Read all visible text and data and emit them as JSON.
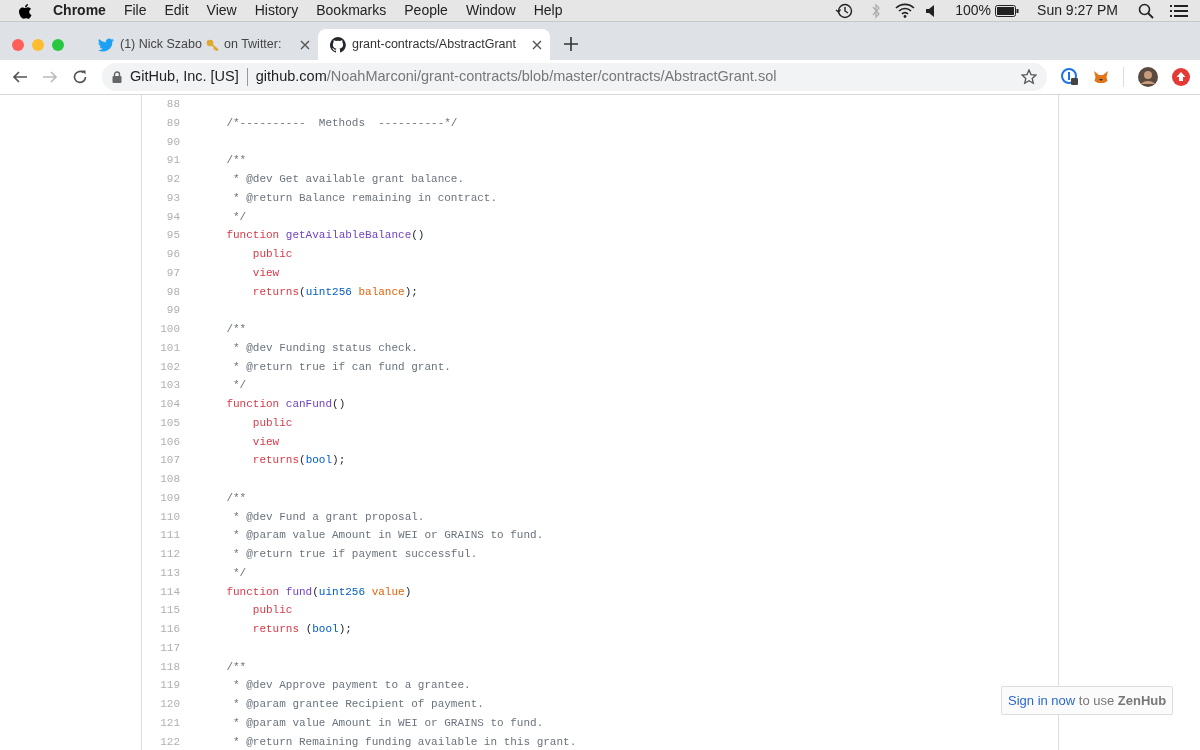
{
  "menu_bar": {
    "app": "Chrome",
    "items": [
      "File",
      "Edit",
      "View",
      "History",
      "Bookmarks",
      "People",
      "Window",
      "Help"
    ],
    "battery": "100%",
    "clock": "Sun 9:27 PM"
  },
  "tabs": [
    {
      "kind": "twitter",
      "title": "(1) Nick Szabo",
      "title_after_icon": "on Twitter:",
      "selected": false
    },
    {
      "kind": "github",
      "title": "grant-contracts/AbstractGrant",
      "selected": true
    }
  ],
  "toolbar": {
    "back_enabled": true,
    "forward_enabled": false,
    "identity": "GitHub, Inc. [US]",
    "host": "github.com",
    "path": "/NoahMarconi/grant-contracts/blob/master/contracts/AbstractGrant.sol"
  },
  "code": {
    "lines": [
      {
        "number": "88"
      },
      {
        "number": "89",
        "tokens": [
          {
            "kind": "comment",
            "text": "    /*----------  Methods  ----------*/"
          }
        ]
      },
      {
        "number": "90"
      },
      {
        "number": "91",
        "tokens": [
          {
            "kind": "comment",
            "text": "    /**"
          }
        ]
      },
      {
        "number": "92",
        "tokens": [
          {
            "kind": "comment",
            "text": "     * @dev Get available grant balance."
          }
        ]
      },
      {
        "number": "93",
        "tokens": [
          {
            "kind": "comment",
            "text": "     * @return Balance remaining in contract."
          }
        ]
      },
      {
        "number": "94",
        "tokens": [
          {
            "kind": "comment",
            "text": "     */"
          }
        ]
      },
      {
        "number": "95",
        "tokens": [
          {
            "kind": "keyword",
            "text": "    function"
          },
          {
            "kind": "entity",
            "text": " getAvailableBalance"
          },
          {
            "kind": "plain",
            "text": "()"
          }
        ]
      },
      {
        "number": "96",
        "tokens": [
          {
            "kind": "keyword",
            "text": "        public"
          }
        ]
      },
      {
        "number": "97",
        "tokens": [
          {
            "kind": "keyword",
            "text": "        view"
          }
        ]
      },
      {
        "number": "98",
        "tokens": [
          {
            "kind": "keyword",
            "text": "        returns"
          },
          {
            "kind": "plain",
            "text": "("
          },
          {
            "kind": "type",
            "text": "uint256"
          },
          {
            "kind": "param",
            "text": " balance"
          },
          {
            "kind": "plain",
            "text": ");"
          }
        ]
      },
      {
        "number": "99"
      },
      {
        "number": "100",
        "tokens": [
          {
            "kind": "comment",
            "text": "    /**"
          }
        ]
      },
      {
        "number": "101",
        "tokens": [
          {
            "kind": "comment",
            "text": "     * @dev Funding status check."
          }
        ]
      },
      {
        "number": "102",
        "tokens": [
          {
            "kind": "comment",
            "text": "     * @return true if can fund grant."
          }
        ]
      },
      {
        "number": "103",
        "tokens": [
          {
            "kind": "comment",
            "text": "     */"
          }
        ]
      },
      {
        "number": "104",
        "tokens": [
          {
            "kind": "keyword",
            "text": "    function"
          },
          {
            "kind": "entity",
            "text": " canFund"
          },
          {
            "kind": "plain",
            "text": "()"
          }
        ]
      },
      {
        "number": "105",
        "tokens": [
          {
            "kind": "keyword",
            "text": "        public"
          }
        ]
      },
      {
        "number": "106",
        "tokens": [
          {
            "kind": "keyword",
            "text": "        view"
          }
        ]
      },
      {
        "number": "107",
        "tokens": [
          {
            "kind": "keyword",
            "text": "        returns"
          },
          {
            "kind": "plain",
            "text": "("
          },
          {
            "kind": "type",
            "text": "bool"
          },
          {
            "kind": "plain",
            "text": ");"
          }
        ]
      },
      {
        "number": "108"
      },
      {
        "number": "109",
        "tokens": [
          {
            "kind": "comment",
            "text": "    /**"
          }
        ]
      },
      {
        "number": "110",
        "tokens": [
          {
            "kind": "comment",
            "text": "     * @dev Fund a grant proposal."
          }
        ]
      },
      {
        "number": "111",
        "tokens": [
          {
            "kind": "comment",
            "text": "     * @param value Amount in WEI or GRAINS to fund."
          }
        ]
      },
      {
        "number": "112",
        "tokens": [
          {
            "kind": "comment",
            "text": "     * @return true if payment successful."
          }
        ]
      },
      {
        "number": "113",
        "tokens": [
          {
            "kind": "comment",
            "text": "     */"
          }
        ]
      },
      {
        "number": "114",
        "tokens": [
          {
            "kind": "keyword",
            "text": "    function"
          },
          {
            "kind": "entity",
            "text": " fund"
          },
          {
            "kind": "plain",
            "text": "("
          },
          {
            "kind": "type",
            "text": "uint256"
          },
          {
            "kind": "param",
            "text": " value"
          },
          {
            "kind": "plain",
            "text": ")"
          }
        ]
      },
      {
        "number": "115",
        "tokens": [
          {
            "kind": "keyword",
            "text": "        public"
          }
        ]
      },
      {
        "number": "116",
        "tokens": [
          {
            "kind": "keyword",
            "text": "        returns"
          },
          {
            "kind": "plain",
            "text": " ("
          },
          {
            "kind": "type",
            "text": "bool"
          },
          {
            "kind": "plain",
            "text": ");"
          }
        ]
      },
      {
        "number": "117"
      },
      {
        "number": "118",
        "tokens": [
          {
            "kind": "comment",
            "text": "    /**"
          }
        ]
      },
      {
        "number": "119",
        "tokens": [
          {
            "kind": "comment",
            "text": "     * @dev Approve payment to a grantee."
          }
        ]
      },
      {
        "number": "120",
        "tokens": [
          {
            "kind": "comment",
            "text": "     * @param grantee Recipient of payment."
          }
        ]
      },
      {
        "number": "121",
        "tokens": [
          {
            "kind": "comment",
            "text": "     * @param value Amount in WEI or GRAINS to fund."
          }
        ]
      },
      {
        "number": "122",
        "tokens": [
          {
            "kind": "comment",
            "text": "     * @return Remaining funding available in this grant."
          }
        ]
      }
    ]
  },
  "zenhub": {
    "link": "Sign in now",
    "text": "to use **ZenHub**"
  }
}
